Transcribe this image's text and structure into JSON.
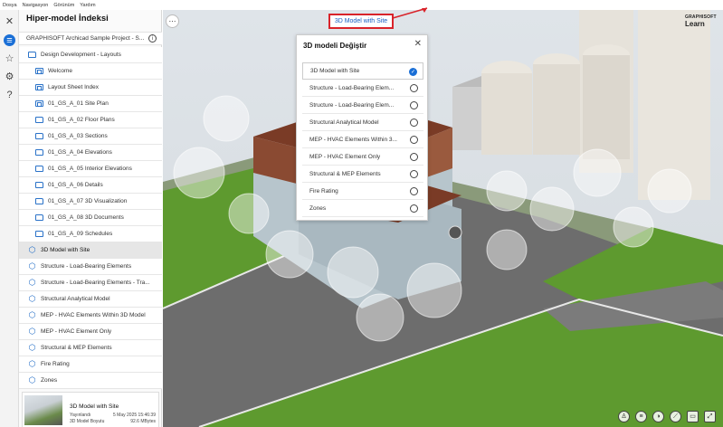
{
  "menubar": [
    "Dosya",
    "Navigasyon",
    "Görünüm",
    "Yardım"
  ],
  "panel": {
    "title": "Hiper-model İndeksi",
    "project": "GRAPHISOFT Archicad Sample Project - S...",
    "items": [
      {
        "label": "Design Development - Layouts",
        "icon": "folder-icon",
        "level": 0,
        "selected": false
      },
      {
        "label": "Welcome",
        "icon": "layout-icon",
        "level": 1,
        "selected": false
      },
      {
        "label": "Layout Sheet Index",
        "icon": "layout-icon",
        "level": 1,
        "selected": false
      },
      {
        "label": "01_GS_A_01 Site Plan",
        "icon": "layout-icon",
        "level": 1,
        "selected": false
      },
      {
        "label": "01_GS_A_02 Floor Plans",
        "icon": "folder-icon",
        "level": 1,
        "selected": false
      },
      {
        "label": "01_GS_A_03 Sections",
        "icon": "folder-icon",
        "level": 1,
        "selected": false
      },
      {
        "label": "01_GS_A_04 Elevations",
        "icon": "folder-icon",
        "level": 1,
        "selected": false
      },
      {
        "label": "01_GS_A_05 Interior Elevations",
        "icon": "folder-icon",
        "level": 1,
        "selected": false
      },
      {
        "label": "01_GS_A_06 Details",
        "icon": "folder-icon",
        "level": 1,
        "selected": false
      },
      {
        "label": "01_GS_A_07 3D Visualization",
        "icon": "folder-icon",
        "level": 1,
        "selected": false
      },
      {
        "label": "01_GS_A_08 3D Documents",
        "icon": "folder-icon",
        "level": 1,
        "selected": false
      },
      {
        "label": "01_GS_A_09 Schedules",
        "icon": "folder-icon",
        "level": 1,
        "selected": false
      },
      {
        "label": "3D Model with Site",
        "icon": "cube-icon",
        "level": 0,
        "selected": true
      },
      {
        "label": "Structure - Load-Bearing Elements",
        "icon": "cube-icon",
        "level": 0,
        "selected": false
      },
      {
        "label": "Structure - Load-Bearing Elements - Tra...",
        "icon": "cube-icon",
        "level": 0,
        "selected": false
      },
      {
        "label": "Structural Analytical Model",
        "icon": "cube-icon",
        "level": 0,
        "selected": false
      },
      {
        "label": "MEP - HVAC Elements Within 3D Model",
        "icon": "cube-icon",
        "level": 0,
        "selected": false
      },
      {
        "label": "MEP - HVAC Element Only",
        "icon": "cube-icon",
        "level": 0,
        "selected": false
      },
      {
        "label": "Structural & MEP Elements",
        "icon": "cube-icon",
        "level": 0,
        "selected": false
      },
      {
        "label": "Fire Rating",
        "icon": "cube-icon",
        "level": 0,
        "selected": false
      },
      {
        "label": "Zones",
        "icon": "cube-icon",
        "level": 0,
        "selected": false
      }
    ],
    "card": {
      "name": "3D Model with Site",
      "status": "Yayınlandı",
      "size_label": "3D Model Boyutu",
      "date": "5 May 2025 15:46:39",
      "size": "92.6 MBytes"
    }
  },
  "viewport": {
    "current_model": "3D Model with Site",
    "logo_top": "GRAPHISOFT",
    "logo_bottom": "Learn"
  },
  "dialog": {
    "title": "3D modeli Değiştir",
    "options": [
      {
        "label": "3D Model with Site",
        "selected": true
      },
      {
        "label": "Structure - Load-Bearing Elem...",
        "selected": false
      },
      {
        "label": "Structure - Load-Bearing Elem...",
        "selected": false
      },
      {
        "label": "Structural Analytical Model",
        "selected": false
      },
      {
        "label": "MEP - HVAC Elements Within 3...",
        "selected": false
      },
      {
        "label": "MEP - HVAC Element Only",
        "selected": false
      },
      {
        "label": "Structural & MEP Elements",
        "selected": false
      },
      {
        "label": "Fire Rating",
        "selected": false
      },
      {
        "label": "Zones",
        "selected": false
      }
    ]
  },
  "colors": {
    "accent": "#1a6fd6",
    "highlight_border": "#d9232a",
    "grass": "#5e9a2f",
    "brick": "#7a3b26"
  }
}
